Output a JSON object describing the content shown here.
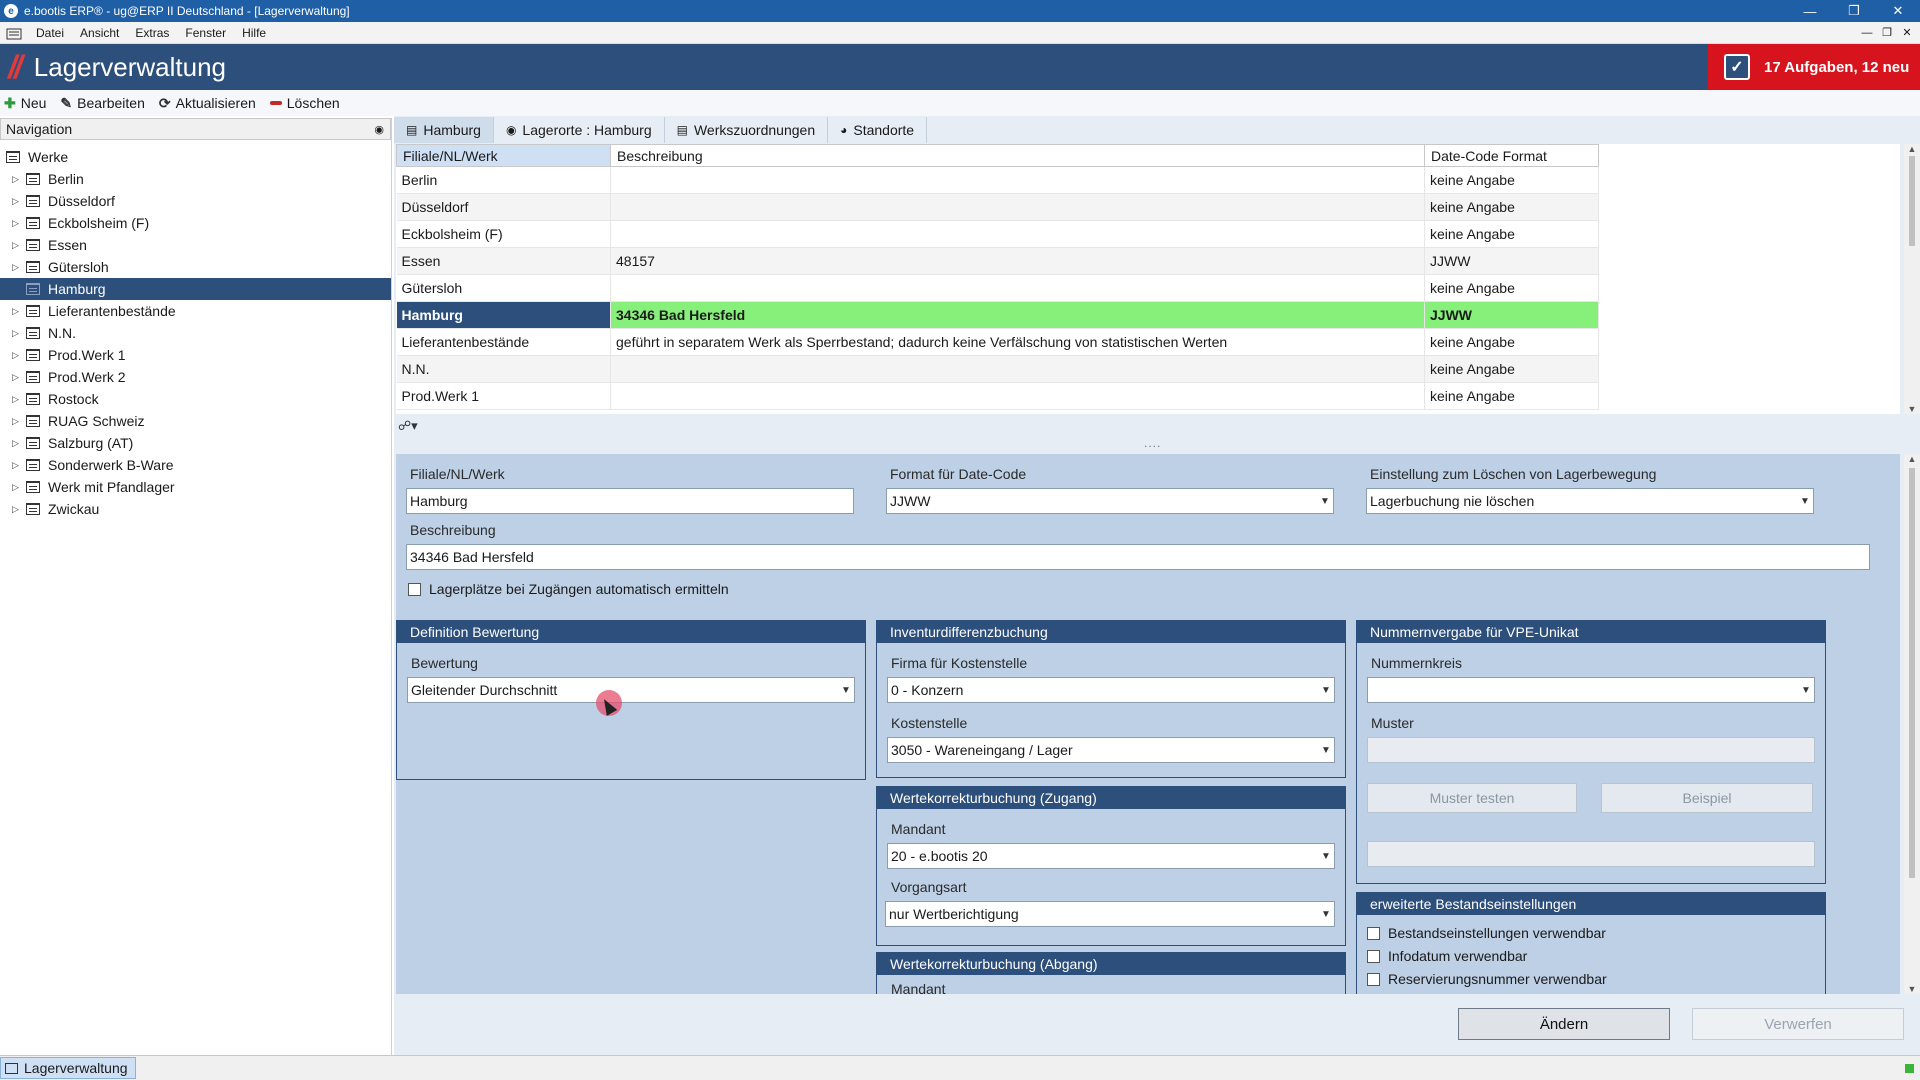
{
  "window": {
    "title": "e.bootis ERP® - ug@ERP II Deutschland - [Lagerverwaltung]",
    "minimize": "—",
    "maximize": "❐",
    "close": "✕"
  },
  "menu": {
    "items": [
      "Datei",
      "Ansicht",
      "Extras",
      "Fenster",
      "Hilfe"
    ]
  },
  "header": {
    "slashes": "//",
    "title": "Lagerverwaltung",
    "tasks": "17 Aufgaben, 12 neu"
  },
  "toolbar": {
    "new": "Neu",
    "edit": "Bearbeiten",
    "refresh": "Aktualisieren",
    "delete": "Löschen"
  },
  "navigation": {
    "title": "Navigation",
    "root": "Werke",
    "items": [
      "Berlin",
      "Düsseldorf",
      "Eckbolsheim (F)",
      "Essen",
      "Gütersloh",
      "Hamburg",
      "Lieferantenbestände",
      "N.N.",
      "Prod.Werk 1",
      "Prod.Werk 2",
      "Rostock",
      "RUAG Schweiz",
      "Salzburg (AT)",
      "Sonderwerk B-Ware",
      "Werk mit Pfandlager",
      "Zwickau"
    ],
    "selected": "Hamburg"
  },
  "tabs": [
    "Hamburg",
    "Lagerorte : Hamburg",
    "Werkszuordnungen",
    "Standorte"
  ],
  "grid": {
    "columns": [
      "Filiale/NL/Werk",
      "Beschreibung",
      "Date-Code Format"
    ],
    "rows": [
      [
        "Berlin",
        "",
        "keine Angabe"
      ],
      [
        "Düsseldorf",
        "",
        "keine Angabe"
      ],
      [
        "Eckbolsheim (F)",
        "",
        "keine Angabe"
      ],
      [
        "Essen",
        "48157",
        "JJWW"
      ],
      [
        "Gütersloh",
        "",
        "keine Angabe"
      ],
      [
        "Hamburg",
        "34346 Bad Hersfeld",
        "JJWW"
      ],
      [
        "Lieferantenbestände",
        "geführt in separatem Werk als Sperrbestand; dadurch keine Verfälschung von statistischen Werten",
        "keine Angabe"
      ],
      [
        "N.N.",
        "",
        "keine Angabe"
      ],
      [
        "Prod.Werk 1",
        "",
        "keine Angabe"
      ]
    ],
    "selected_index": 5,
    "splitter": "....",
    "options_icon": "☍▾"
  },
  "form": {
    "werk_label": "Filiale/NL/Werk",
    "werk_value": "Hamburg",
    "datecode_label": "Format für Date-Code",
    "datecode_value": "JJWW",
    "loeschen_label": "Einstellung zum Löschen von Lagerbewegung",
    "loeschen_value": "Lagerbuchung nie löschen",
    "beschreibung_label": "Beschreibung",
    "beschreibung_value": "34346 Bad Hersfeld",
    "auto_lagerplaetze": "Lagerplätze bei Zugängen automatisch ermitteln",
    "bewertung_group": "Definition Bewertung",
    "bewertung_label": "Bewertung",
    "bewertung_value": "Gleitender Durchschnitt",
    "inventur_group": "Inventurdifferenzbuchung",
    "firma_label": "Firma für Kostenstelle",
    "firma_value": "0 - Konzern",
    "kostenstelle_label": "Kostenstelle",
    "kostenstelle_value": "3050 - Wareneingang / Lager",
    "nummern_group": "Nummernvergabe für VPE-Unikat",
    "nummernkreis_label": "Nummernkreis",
    "nummernkreis_value": "",
    "muster_label": "Muster",
    "muster_testen": "Muster testen",
    "beispiel": "Beispiel",
    "zugang_group": "Wertekorrekturbuchung (Zugang)",
    "mandant_label": "Mandant",
    "mandant_value": "20 - e.bootis 20",
    "vorgangsart_label": "Vorgangsart",
    "vorgangsart_value": "nur Wertberichtigung",
    "abgang_group": "Wertekorrekturbuchung (Abgang)",
    "abgang_mandant_label": "Mandant",
    "bestand_group": "erweiterte Bestandseinstellungen",
    "bestand_opt1": "Bestandseinstellungen verwendbar",
    "bestand_opt2": "Infodatum verwendbar",
    "bestand_opt3": "Reservierungsnummer verwendbar"
  },
  "actions": {
    "aendern": "Ändern",
    "verwerfen": "Verwerfen"
  },
  "status": {
    "tab": "Lagerverwaltung"
  },
  "colors": {
    "header_bg": "#2c4f7c",
    "selection_green": "#86f07a",
    "badge_red": "#d7141e",
    "form_bg": "#bdd0e6"
  }
}
